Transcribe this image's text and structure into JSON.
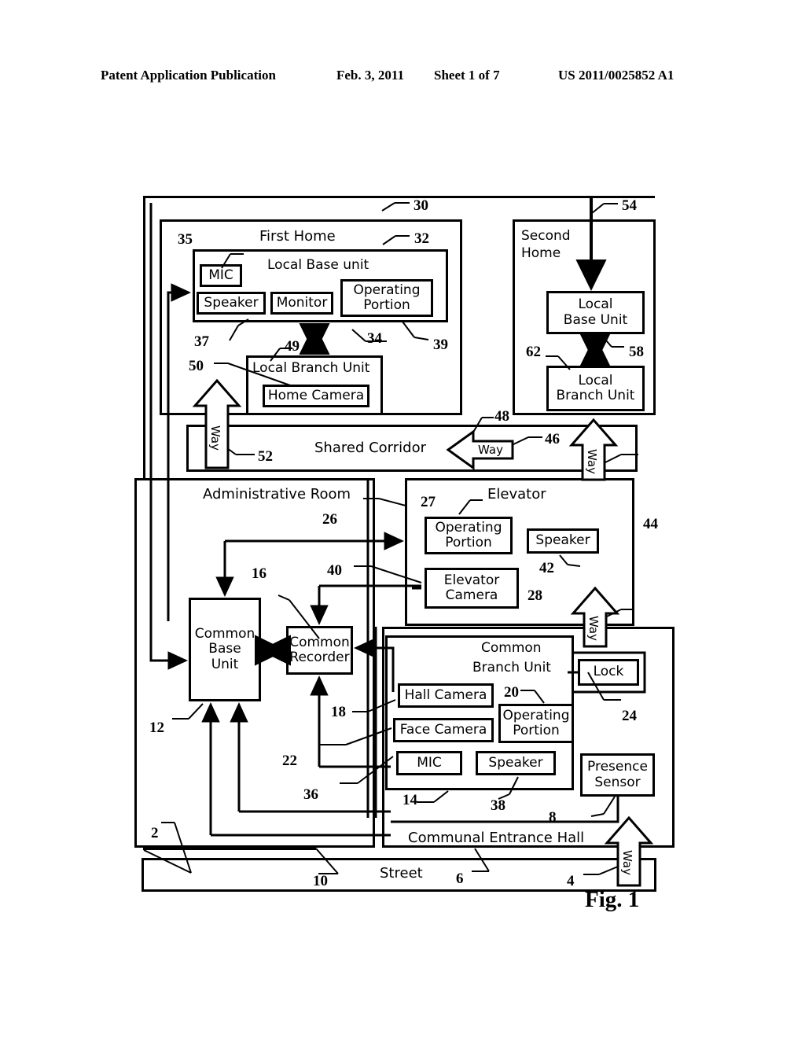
{
  "header": {
    "publication": "Patent Application Publication",
    "date": "Feb. 3, 2011",
    "sheet": "Sheet 1 of 7",
    "number": "US 2011/0025852 A1"
  },
  "figure_label": "Fig. 1",
  "diagram": {
    "title": "Fig. 1",
    "rooms": [
      {
        "id": "first-home",
        "label": "First Home",
        "ref": "30"
      },
      {
        "id": "second-home",
        "label": "Second Home",
        "ref": "54"
      },
      {
        "id": "shared-corridor",
        "label": "Shared Corridor",
        "ref": "48"
      },
      {
        "id": "administrative-room",
        "label": "Administrative Room",
        "ref": "26"
      },
      {
        "id": "elevator",
        "label": "Elevator",
        "ref": "44"
      },
      {
        "id": "communal-entrance-hall",
        "label": "Communal Entrance Hall",
        "ref": "8"
      },
      {
        "id": "street",
        "label": "Street",
        "ref": "6"
      }
    ],
    "units": [
      {
        "id": "local-base-unit-1",
        "label": "Local Base unit",
        "ref": "32"
      },
      {
        "id": "local-branch-unit-1",
        "label": "Local Branch Unit",
        "ref": "50"
      },
      {
        "id": "local-base-unit-2",
        "label": "Local Base Unit",
        "ref": "58"
      },
      {
        "id": "local-branch-unit-2",
        "label": "Local Branch Unit",
        "ref": "62"
      },
      {
        "id": "common-base-unit",
        "label": "Common Base Unit",
        "ref": "12"
      },
      {
        "id": "common-recorder",
        "label": "Common Recorder",
        "ref": "16"
      },
      {
        "id": "common-branch-unit",
        "label": "Common Branch Unit",
        "ref": "14"
      }
    ],
    "components": [
      {
        "id": "mic-home",
        "label": "MIC",
        "ref": "35"
      },
      {
        "id": "speaker-home",
        "label": "Speaker",
        "ref": "37"
      },
      {
        "id": "monitor-home",
        "label": "Monitor",
        "ref": "34"
      },
      {
        "id": "operating-portion-home",
        "label": "Operating Portion",
        "ref": "39"
      },
      {
        "id": "home-camera",
        "label": "Home Camera",
        "ref": "49"
      },
      {
        "id": "operating-portion-elevator",
        "label": "Operating Portion",
        "ref": "27"
      },
      {
        "id": "speaker-elevator",
        "label": "Speaker",
        "ref": "42"
      },
      {
        "id": "elevator-camera",
        "label": "Elevator Camera",
        "ref": "28"
      },
      {
        "id": "hall-camera",
        "label": "Hall Camera",
        "ref": "18"
      },
      {
        "id": "face-camera",
        "label": "Face Camera",
        "ref": "22"
      },
      {
        "id": "mic-entrance",
        "label": "MIC",
        "ref": "36"
      },
      {
        "id": "speaker-entrance",
        "label": "Speaker",
        "ref": "38"
      },
      {
        "id": "operating-portion-entrance",
        "label": "Operating Portion",
        "ref": "20"
      },
      {
        "id": "lock",
        "label": "Lock",
        "ref": "24"
      },
      {
        "id": "presence-sensor",
        "label": "Presence Sensor",
        "ref": "24"
      }
    ],
    "way_arrows": [
      {
        "id": "way-street-to-hall",
        "label": "Way",
        "ref": "4",
        "direction": "up"
      },
      {
        "id": "way-hall-to-elevator",
        "label": "Way",
        "ref": "28",
        "direction": "up"
      },
      {
        "id": "way-elevator-to-corridor",
        "label": "Way",
        "ref": "46",
        "direction": "up"
      },
      {
        "id": "way-corridor-left",
        "label": "Way",
        "ref": "46",
        "direction": "left"
      },
      {
        "id": "way-corridor-to-home",
        "label": "Way",
        "ref": "52",
        "direction": "up"
      }
    ],
    "reference_numerals": [
      {
        "n": "2"
      },
      {
        "n": "4"
      },
      {
        "n": "6"
      },
      {
        "n": "8"
      },
      {
        "n": "10"
      },
      {
        "n": "12"
      },
      {
        "n": "14"
      },
      {
        "n": "16"
      },
      {
        "n": "18"
      },
      {
        "n": "20"
      },
      {
        "n": "22"
      },
      {
        "n": "24"
      },
      {
        "n": "26"
      },
      {
        "n": "27"
      },
      {
        "n": "28"
      },
      {
        "n": "30"
      },
      {
        "n": "32"
      },
      {
        "n": "34"
      },
      {
        "n": "35"
      },
      {
        "n": "36"
      },
      {
        "n": "37"
      },
      {
        "n": "38"
      },
      {
        "n": "39"
      },
      {
        "n": "40"
      },
      {
        "n": "42"
      },
      {
        "n": "44"
      },
      {
        "n": "46"
      },
      {
        "n": "48"
      },
      {
        "n": "49"
      },
      {
        "n": "50"
      },
      {
        "n": "52"
      },
      {
        "n": "54"
      },
      {
        "n": "58"
      },
      {
        "n": "62"
      }
    ]
  },
  "labels": {
    "first_home": "First Home",
    "second_home": "Second\nHome",
    "second_home_l1": "Second",
    "second_home_l2": "Home",
    "local_base_unit_lc": "Local Base unit",
    "local_base_unit_l1": "Local",
    "local_base_unit_l2": "Base Unit",
    "local_branch_unit": "Local Branch Unit",
    "local_branch_unit_l1": "Local",
    "local_branch_unit_l2": "Branch Unit",
    "mic": "MIC",
    "speaker": "Speaker",
    "monitor": "Monitor",
    "operating": "Operating",
    "portion": "Portion",
    "home_camera": "Home Camera",
    "shared_corridor": "Shared Corridor",
    "administrative_room": "Administrative Room",
    "elevator": "Elevator",
    "elevator_camera_l1": "Elevator",
    "elevator_camera_l2": "Camera",
    "common_base_l1": "Common",
    "common_base_l2": "Base",
    "common_base_l3": "Unit",
    "common_recorder_l1": "Common",
    "common_recorder_l2": "Recorder",
    "common_branch_l1": "Common",
    "common_branch_l2": "Branch Unit",
    "hall_camera": "Hall Camera",
    "face_camera": "Face Camera",
    "lock": "Lock",
    "presence_l1": "Presence",
    "presence_l2": "Sensor",
    "communal_entrance_hall": "Communal Entrance Hall",
    "street": "Street",
    "way": "Way"
  },
  "numerals": {
    "n2": "2",
    "n4": "4",
    "n6": "6",
    "n8": "8",
    "n10": "10",
    "n12": "12",
    "n14": "14",
    "n16": "16",
    "n18": "18",
    "n20": "20",
    "n22": "22",
    "n24": "24",
    "n26": "26",
    "n27": "27",
    "n28": "28",
    "n30": "30",
    "n32": "32",
    "n34": "34",
    "n35": "35",
    "n36": "36",
    "n37": "37",
    "n38": "38",
    "n39": "39",
    "n40": "40",
    "n42": "42",
    "n44": "44",
    "n46": "46",
    "n48": "48",
    "n49": "49",
    "n50": "50",
    "n52": "52",
    "n54": "54",
    "n58": "58",
    "n62": "62"
  },
  "colors": {
    "ink": "#000000",
    "paper": "#ffffff"
  }
}
